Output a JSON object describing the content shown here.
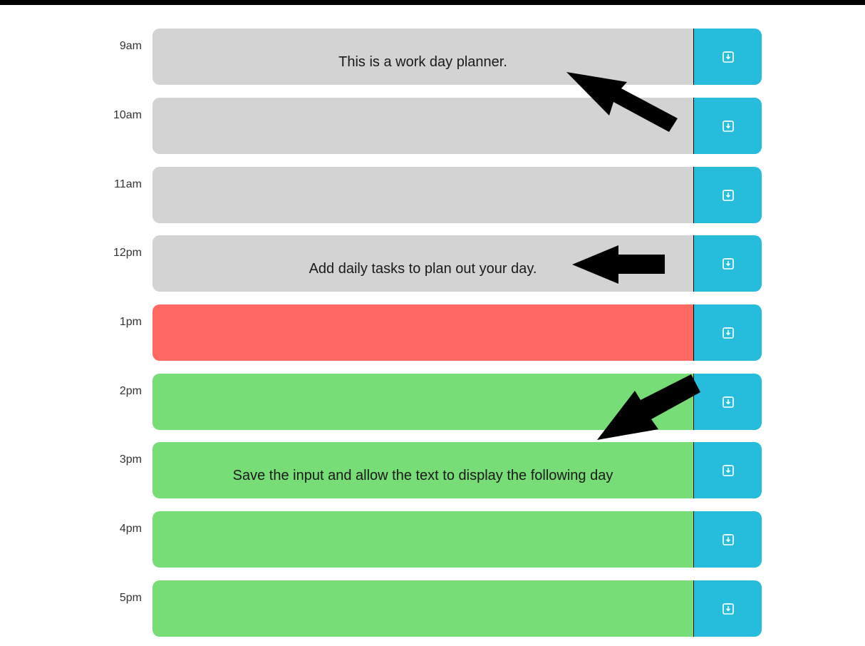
{
  "colors": {
    "past": "#d3d3d3",
    "present": "#ff6961",
    "future": "#77dd77",
    "save": "#26bcdb",
    "save_icon": "#ffffff",
    "arrow": "#000000"
  },
  "planner": {
    "rows": [
      {
        "hour": "9am",
        "state": "past",
        "text": "This is a work day planner.",
        "save_icon": "save-icon"
      },
      {
        "hour": "10am",
        "state": "past",
        "text": "",
        "save_icon": "save-icon"
      },
      {
        "hour": "11am",
        "state": "past",
        "text": "",
        "save_icon": "save-icon"
      },
      {
        "hour": "12pm",
        "state": "past",
        "text": "Add daily tasks to plan out your day.",
        "save_icon": "save-icon"
      },
      {
        "hour": "1pm",
        "state": "present",
        "text": "",
        "save_icon": "save-icon"
      },
      {
        "hour": "2pm",
        "state": "future",
        "text": "",
        "save_icon": "save-icon"
      },
      {
        "hour": "3pm",
        "state": "future",
        "text": "Save the input and allow the text to display the following day",
        "save_icon": "save-icon"
      },
      {
        "hour": "4pm",
        "state": "future",
        "text": "",
        "save_icon": "save-icon"
      },
      {
        "hour": "5pm",
        "state": "future",
        "text": "",
        "save_icon": "save-icon"
      }
    ]
  },
  "annotations": [
    "arrow-icon",
    "arrow-icon",
    "arrow-icon"
  ]
}
